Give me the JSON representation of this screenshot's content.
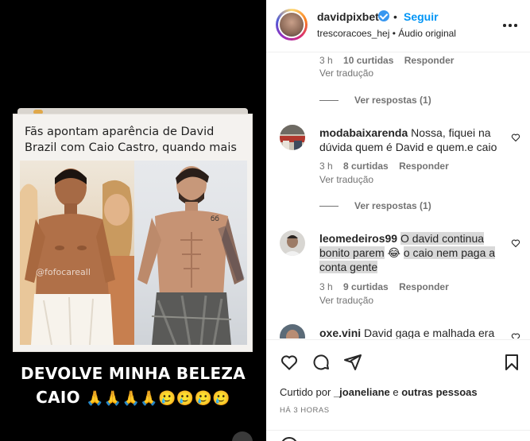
{
  "post": {
    "headline": "Fãs apontam aparência de David Brazil com Caio Castro, quando mais novo",
    "watermark": "@fofocareall",
    "caption_line1": "DEVOLVE MINHA BELEZA",
    "caption_line2": "CAIO",
    "caption_emojis": "🙏🙏🙏🙏🥲🥲🥲🥲"
  },
  "header": {
    "username": "davidpixbet",
    "separator": "•",
    "follow_label": "Seguir",
    "subline": "trescoracoes_hej • Áudio original"
  },
  "comments": [
    {
      "meta_time": "3 h",
      "meta_likes": "10 curtidas",
      "reply_label": "Responder",
      "translate_label": "Ver tradução",
      "view_replies": "Ver respostas (1)"
    },
    {
      "user": "modabaixarenda",
      "text": "Nossa, fiquei na dúvida quem é David e quem.e caio",
      "meta_time": "3 h",
      "meta_likes": "8 curtidas",
      "reply_label": "Responder",
      "translate_label": "Ver tradução",
      "view_replies": "Ver respostas (1)"
    },
    {
      "user": "leomedeiros99",
      "text_a": "O david continua bonito parem",
      "emoji": "😂",
      "text_b": "o caio nem paga a conta gente",
      "meta_time": "3 h",
      "meta_likes": "9 curtidas",
      "reply_label": "Responder",
      "translate_label": "Ver tradução"
    },
    {
      "user": "oxe.vini",
      "text": "David gaga e malhada era"
    }
  ],
  "footer": {
    "liked_by_prefix": "Curtido por",
    "liked_by_user": "_joaneliane",
    "liked_by_suffix": "e",
    "liked_by_others": "outras pessoas",
    "time_ago": "HÁ 3 HORAS"
  },
  "icons": [
    "heart-icon",
    "comment-icon",
    "share-icon",
    "bookmark-icon",
    "more-options-icon",
    "verified-badge-icon",
    "emoji-icon"
  ],
  "colors": {
    "link": "#0095f6",
    "text": "#262626",
    "muted": "#737373",
    "verified": "#3897f0",
    "highlight": "#d9d9d9"
  }
}
